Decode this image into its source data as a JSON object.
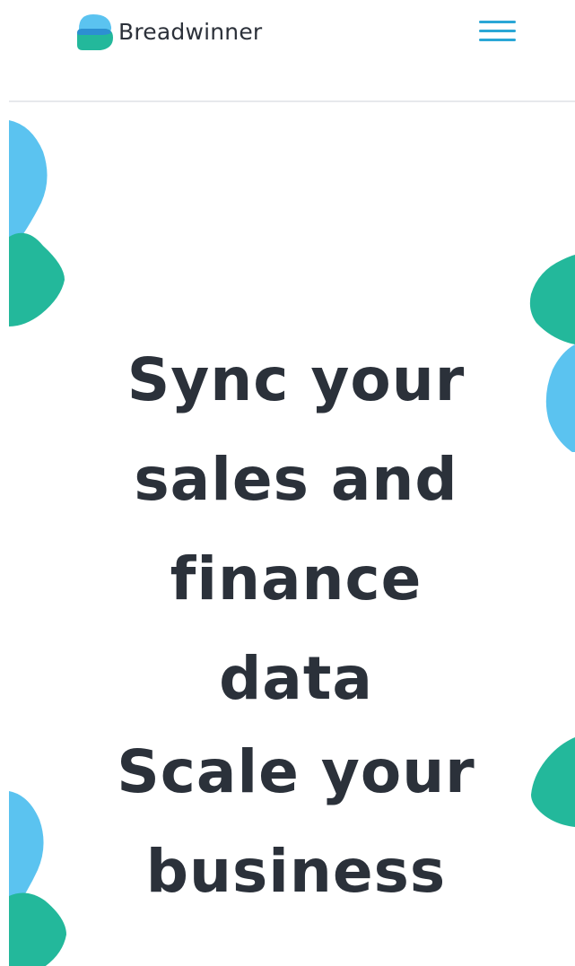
{
  "brand": {
    "name": "Breadwinner",
    "logo_icon": "breadwinner-logo-icon",
    "colors": {
      "blue": "#5bc3f0",
      "teal": "#23b89b",
      "accent": "#2aa7d6",
      "text": "#2b313a"
    }
  },
  "header": {
    "menu_icon": "hamburger-menu-icon"
  },
  "hero": {
    "headline_line1": "Sync your",
    "headline_line2": "sales and",
    "headline_line3": "finance",
    "headline_line4": "data",
    "subheadline_line1": "Scale your",
    "subheadline_line2": "business"
  }
}
